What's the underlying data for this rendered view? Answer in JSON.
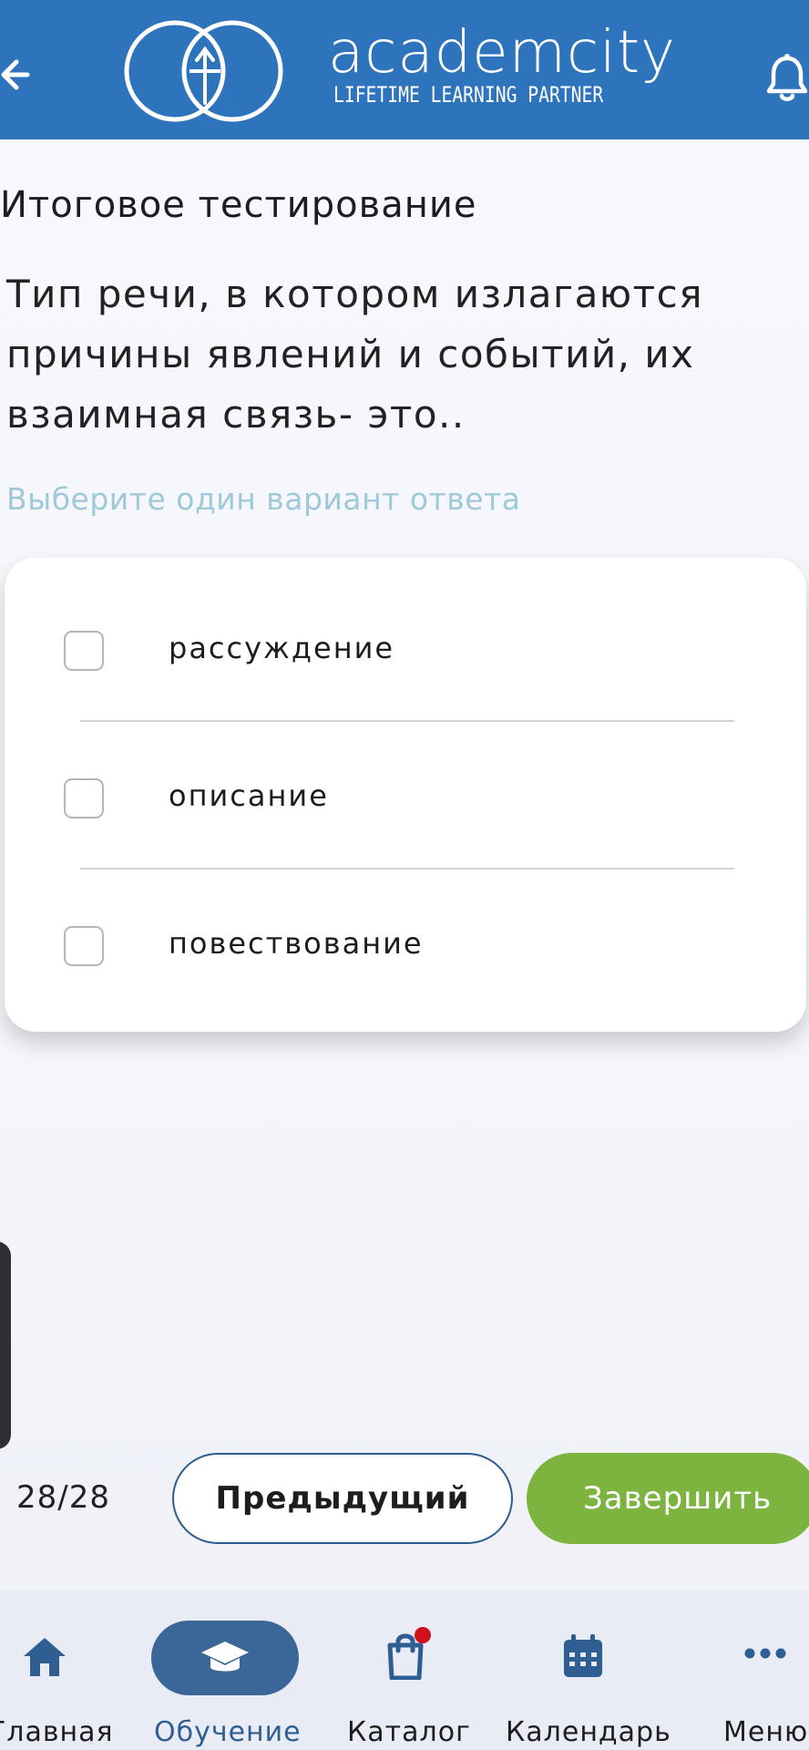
{
  "header": {
    "brand": "academcity",
    "tagline": "LIFETIME LEARNING PARTNER",
    "back_icon": "arrow-left-icon",
    "bell_icon": "bell-icon",
    "color": "#2e74bd"
  },
  "test": {
    "title": "Итоговое тестирование",
    "question": "Тип речи, в котором излагаются причины явлений и событий, их взаимная связь- это..",
    "hint": "Выберите один вариант ответа",
    "options": [
      {
        "label": "рассуждение",
        "checked": false
      },
      {
        "label": "описание",
        "checked": false
      },
      {
        "label": "повествование",
        "checked": false
      }
    ]
  },
  "footer": {
    "counter": "28/28",
    "prev_label": "Предыдущий",
    "finish_label": "Завершить",
    "finish_color": "#7db33f"
  },
  "nav": {
    "items": [
      {
        "label": "Главная",
        "icon": "home-icon"
      },
      {
        "label": "Обучение",
        "icon": "graduation-cap-icon",
        "active": true
      },
      {
        "label": "Каталог",
        "icon": "shopping-bag-icon",
        "badge": true
      },
      {
        "label": "Календарь",
        "icon": "calendar-icon"
      },
      {
        "label": "Меню",
        "icon": "more-dots-icon"
      }
    ],
    "active_color": "#3a6797",
    "icon_color": "#2e5e92"
  }
}
